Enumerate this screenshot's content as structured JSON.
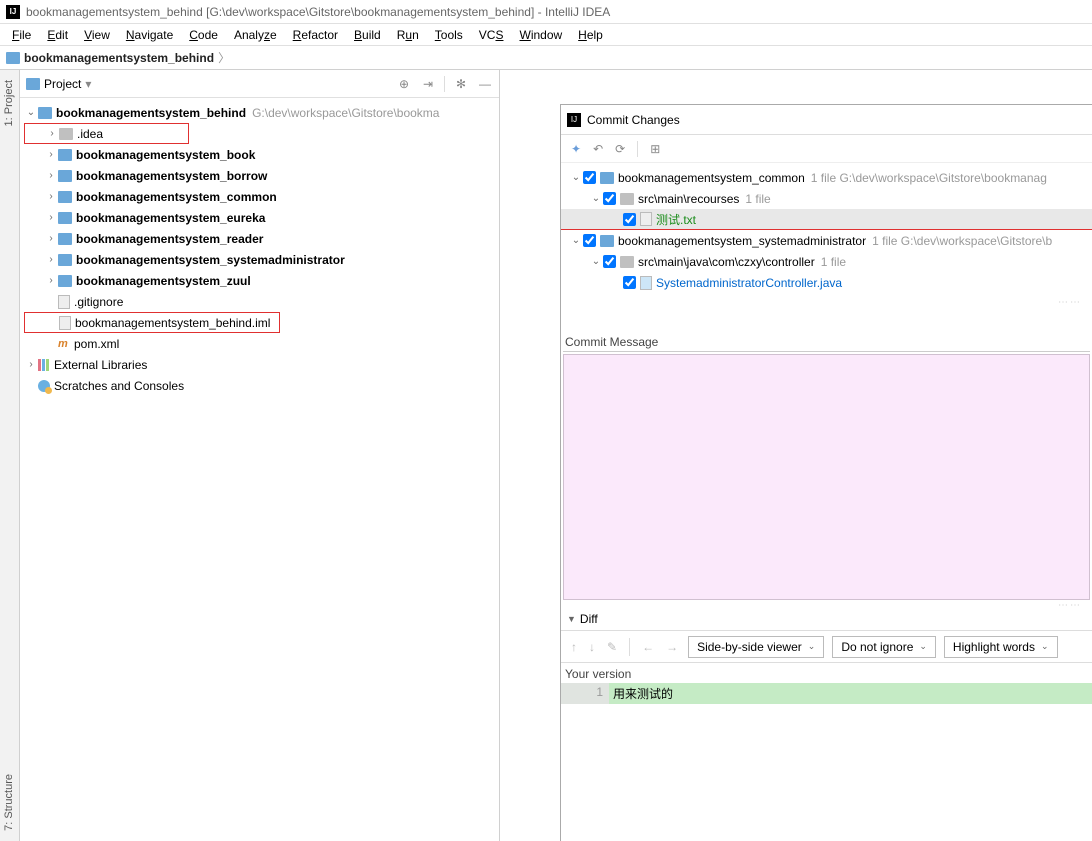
{
  "window": {
    "title": "bookmanagementsystem_behind [G:\\dev\\workspace\\Gitstore\\bookmanagementsystem_behind] - IntelliJ IDEA"
  },
  "menu": {
    "file": "File",
    "edit": "Edit",
    "view": "View",
    "navigate": "Navigate",
    "code": "Code",
    "analyze": "Analyze",
    "refactor": "Refactor",
    "build": "Build",
    "run": "Run",
    "tools": "Tools",
    "vcs": "VCS",
    "window": "Window",
    "help": "Help"
  },
  "breadcrumb": {
    "root": "bookmanagementsystem_behind"
  },
  "side": {
    "project": "1: Project",
    "structure": "7: Structure"
  },
  "panel": {
    "title": "Project"
  },
  "tree": {
    "root": "bookmanagementsystem_behind",
    "root_path": "G:\\dev\\workspace\\Gitstore\\bookma",
    "idea": ".idea",
    "m1": "bookmanagementsystem_book",
    "m2": "bookmanagementsystem_borrow",
    "m3": "bookmanagementsystem_common",
    "m4": "bookmanagementsystem_eureka",
    "m5": "bookmanagementsystem_reader",
    "m6": "bookmanagementsystem_systemadministrator",
    "m7": "bookmanagementsystem_zuul",
    "gitignore": ".gitignore",
    "iml": "bookmanagementsystem_behind.iml",
    "pom": "pom.xml",
    "ext": "External Libraries",
    "scratch": "Scratches and Consoles"
  },
  "commit": {
    "title": "Commit Changes",
    "mod_common": "bookmanagementsystem_common",
    "mod_common_info": "1 file  G:\\dev\\workspace\\Gitstore\\bookmanag",
    "path_res": "src\\main\\recourses",
    "path_res_info": "1 file",
    "file_test": "测试.txt",
    "mod_sys": "bookmanagementsystem_systemadministrator",
    "mod_sys_info": "1 file  G:\\dev\\workspace\\Gitstore\\b",
    "path_ctrl": "src\\main\\java\\com\\czxy\\controller",
    "path_ctrl_info": "1 file",
    "file_java": "SystemadministratorController.java",
    "msg_label": "Commit Message",
    "diff_label": "Diff",
    "combo_viewer": "Side-by-side viewer",
    "combo_ignore": "Do not ignore",
    "combo_highlight": "Highlight words",
    "your_version": "Your version",
    "line_no": "1",
    "diff_text": "用来测试的"
  }
}
